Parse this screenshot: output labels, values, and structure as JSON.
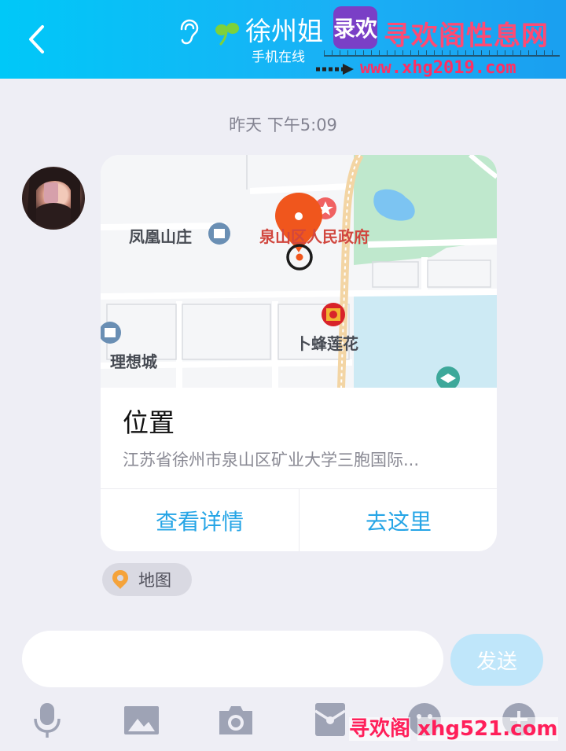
{
  "header": {
    "title": "徐州姐",
    "subtitle": "手机在线",
    "back_icon": "chevron-left-icon",
    "ear_icon": "ear-icon",
    "sprout_icon": "sprout-icon"
  },
  "watermark_top": {
    "logo_text": "录欢",
    "site_name": "寻欢阁性息网",
    "url": "www.xhg2019.com"
  },
  "chat": {
    "timestamp": "昨天 下午5:09"
  },
  "location_card": {
    "map_labels": {
      "fenghuang": "凤凰山庄",
      "government": "泉山区人民政府",
      "lixiang": "理想城",
      "bufeng": "卜蜂莲花"
    },
    "title": "位置",
    "address": "江苏省徐州市泉山区矿业大学三胞国际...",
    "view_details_label": "查看详情",
    "go_here_label": "去这里"
  },
  "map_tag": {
    "label": "地图"
  },
  "input": {
    "placeholder": "",
    "send_label": "发送"
  },
  "toolbar": {
    "items": [
      "microphone-icon",
      "image-icon",
      "camera-icon",
      "red-packet-icon",
      "emoji-icon",
      "plus-icon"
    ]
  },
  "watermark_bottom": {
    "text": "寻欢阁",
    "url": "xhg521.com"
  },
  "colors": {
    "header_start": "#00c8f8",
    "header_end": "#1a9ff0",
    "accent": "#26a5e6",
    "pin": "#f0561d",
    "send_disabled": "#bfe6fa"
  }
}
